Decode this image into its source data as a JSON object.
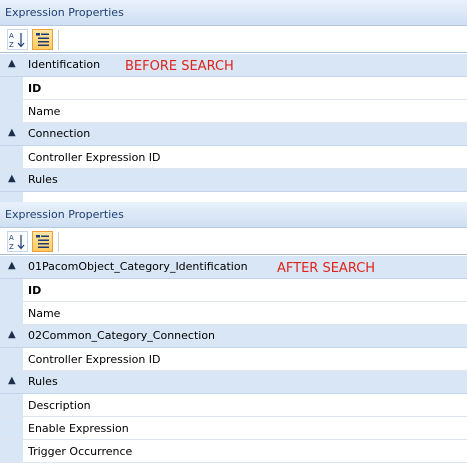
{
  "before": {
    "panel_title": "Expression Properties",
    "annotation": "BEFORE SEARCH",
    "categories": [
      {
        "label": "Identification",
        "properties": [
          {
            "label": "ID",
            "bold": true
          },
          {
            "label": "Name",
            "bold": false
          }
        ]
      },
      {
        "label": "Connection",
        "properties": [
          {
            "label": "Controller Expression ID",
            "bold": false
          }
        ]
      },
      {
        "label": "Rules",
        "properties": []
      }
    ]
  },
  "after": {
    "panel_title": "Expression Properties",
    "annotation": "AFTER SEARCH",
    "categories": [
      {
        "label": "01PacomObject_Category_Identification",
        "properties": [
          {
            "label": "ID",
            "bold": true
          },
          {
            "label": "Name",
            "bold": false
          }
        ]
      },
      {
        "label": "02Common_Category_Connection",
        "properties": [
          {
            "label": "Controller Expression ID",
            "bold": false
          }
        ]
      },
      {
        "label": "Rules",
        "properties": [
          {
            "label": "Description",
            "bold": false
          },
          {
            "label": "Enable Expression",
            "bold": false
          },
          {
            "label": "Trigger Occurrence",
            "bold": false
          }
        ]
      }
    ]
  },
  "toolbar": {
    "sort_icon": "sort-alphabetical-icon",
    "categorized_icon": "categorized-icon",
    "active_color": "#ffcb61"
  },
  "colors": {
    "annotation": "#e0231b",
    "category_background": "#d9e6f5",
    "title_text": "#1d3f75"
  }
}
